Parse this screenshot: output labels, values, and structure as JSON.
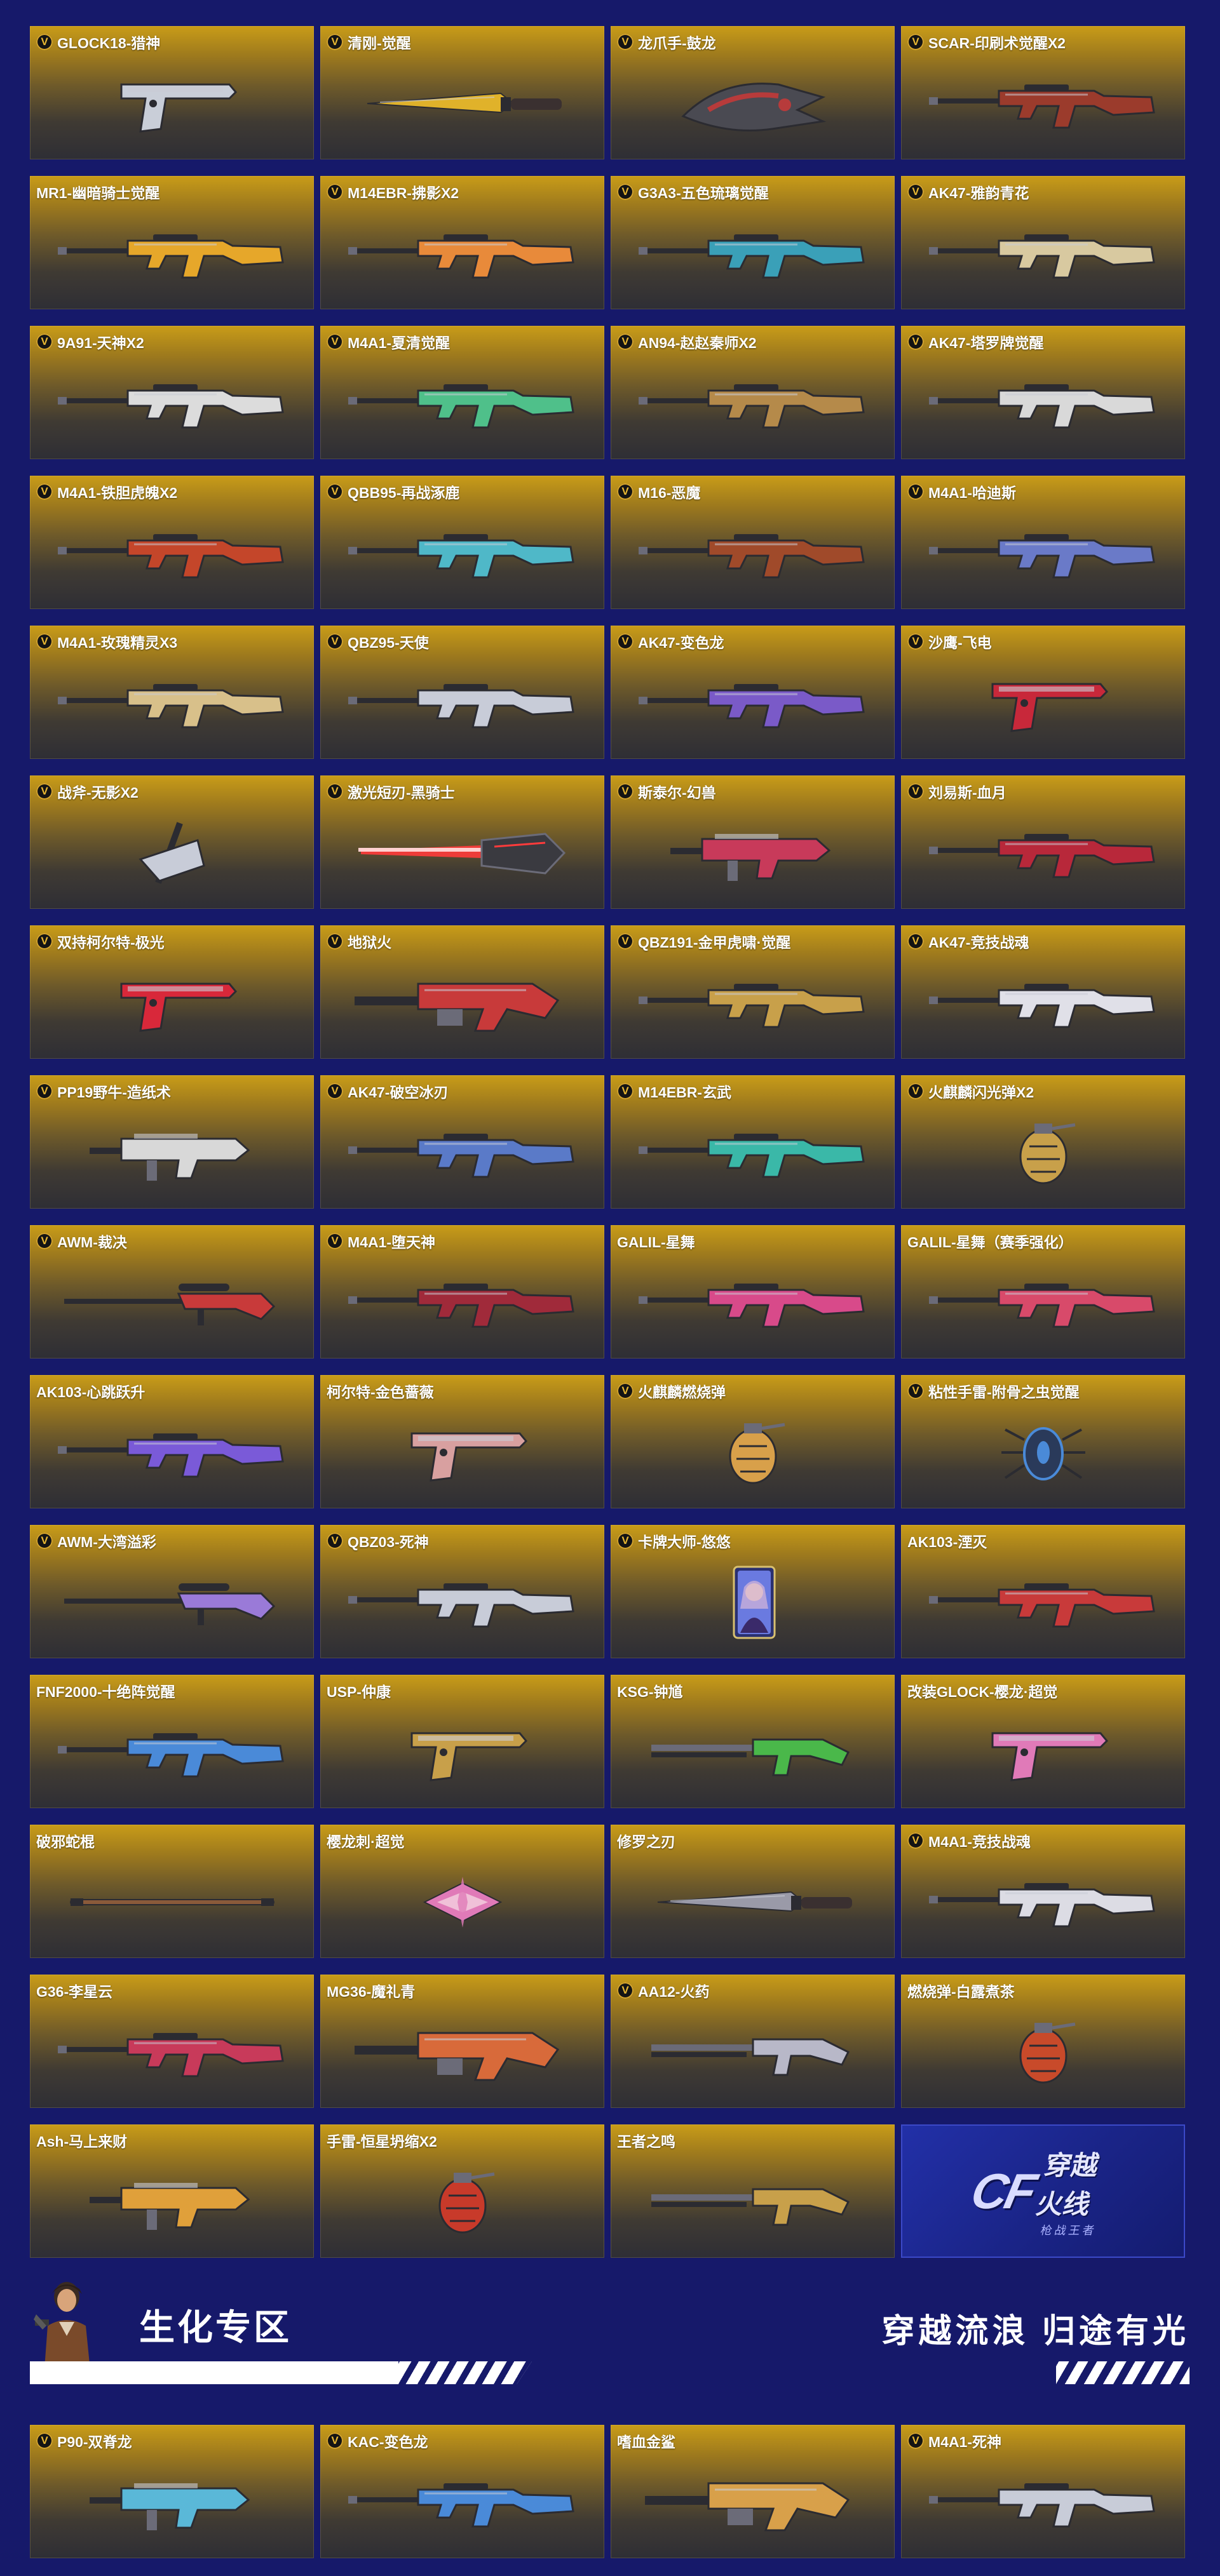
{
  "sections": {
    "bio_title": "生化专区",
    "slogan": "穿越流浪 归途有光",
    "logo_text": "穿越火线",
    "logo_sub": "枪战王者"
  },
  "colors": {
    "page_bg": "#16196a",
    "card_top": "#c99c18",
    "card_bottom": "#2e2e35",
    "badge_gold": "#e9b833"
  },
  "weapons": [
    {
      "name": "GLOCK18-猎神",
      "v": true,
      "icon": "pistol",
      "accent": "#c9ced8"
    },
    {
      "name": "清刚-觉醒",
      "v": true,
      "icon": "knife",
      "accent": "#e0b22a"
    },
    {
      "name": "龙爪手-鼓龙",
      "v": true,
      "icon": "claw",
      "accent": "#b73b3b"
    },
    {
      "name": "SCAR-印刷术觉醒X2",
      "v": true,
      "icon": "rifle",
      "accent": "#9b3b2c"
    },
    {
      "name": "MR1-幽暗骑士觉醒",
      "v": false,
      "icon": "rifle",
      "accent": "#e6a72a"
    },
    {
      "name": "M14EBR-拂影X2",
      "v": true,
      "icon": "rifle",
      "accent": "#e88a3a"
    },
    {
      "name": "G3A3-五色琉璃觉醒",
      "v": true,
      "icon": "rifle",
      "accent": "#3aa0b8"
    },
    {
      "name": "AK47-雅韵青花",
      "v": true,
      "icon": "rifle",
      "accent": "#d8c9a0"
    },
    {
      "name": "9A91-天神X2",
      "v": true,
      "icon": "rifle",
      "accent": "#dcdcdc"
    },
    {
      "name": "M4A1-夏清觉醒",
      "v": true,
      "icon": "rifle",
      "accent": "#4fc08a"
    },
    {
      "name": "AN94-赵赵秦师X2",
      "v": true,
      "icon": "rifle",
      "accent": "#b58a4a"
    },
    {
      "name": "AK47-塔罗牌觉醒",
      "v": true,
      "icon": "rifle",
      "accent": "#d9d9d9"
    },
    {
      "name": "M4A1-铁胆虎魄X2",
      "v": true,
      "icon": "rifle",
      "accent": "#c4462a"
    },
    {
      "name": "QBB95-再战涿鹿",
      "v": true,
      "icon": "rifle",
      "accent": "#4fb8c8"
    },
    {
      "name": "M16-恶魔",
      "v": true,
      "icon": "rifle",
      "accent": "#a04a2a"
    },
    {
      "name": "M4A1-哈迪斯",
      "v": true,
      "icon": "rifle",
      "accent": "#6a7ac8"
    },
    {
      "name": "M4A1-玫瑰精灵X3",
      "v": true,
      "icon": "rifle",
      "accent": "#d8c08a"
    },
    {
      "name": "QBZ95-天使",
      "v": true,
      "icon": "rifle",
      "accent": "#c8ccd8"
    },
    {
      "name": "AK47-变色龙",
      "v": true,
      "icon": "rifle",
      "accent": "#7a5ac8"
    },
    {
      "name": "沙鹰-飞电",
      "v": true,
      "icon": "pistol",
      "accent": "#c8283a"
    },
    {
      "name": "战斧-无影X2",
      "v": true,
      "icon": "axe",
      "accent": "#c8ccd8"
    },
    {
      "name": "激光短刃-黑骑士",
      "v": true,
      "icon": "laser",
      "accent": "#ff3b3b"
    },
    {
      "name": "斯泰尔-幻兽",
      "v": true,
      "icon": "smg",
      "accent": "#c83a5a"
    },
    {
      "name": "刘易斯-血月",
      "v": true,
      "icon": "rifle",
      "accent": "#b8283a"
    },
    {
      "name": "双持柯尔特-极光",
      "v": true,
      "icon": "pistol",
      "accent": "#d8283a"
    },
    {
      "name": "地狱火",
      "v": true,
      "icon": "heavy",
      "accent": "#c83a3a"
    },
    {
      "name": "QBZ191-金甲虎啸·觉醒",
      "v": true,
      "icon": "rifle",
      "accent": "#c8a04a"
    },
    {
      "name": "AK47-竞技战魂",
      "v": true,
      "icon": "rifle",
      "accent": "#e0e0e8"
    },
    {
      "name": "PP19野牛-造纸术",
      "v": true,
      "icon": "smg",
      "accent": "#d8d8d8"
    },
    {
      "name": "AK47-破空冰刃",
      "v": true,
      "icon": "rifle",
      "accent": "#5a7ac8"
    },
    {
      "name": "M14EBR-玄武",
      "v": true,
      "icon": "rifle",
      "accent": "#3ab8a8"
    },
    {
      "name": "火麒麟闪光弹X2",
      "v": true,
      "icon": "grenade",
      "accent": "#c8a04a"
    },
    {
      "name": "AWM-裁决",
      "v": true,
      "icon": "sniper",
      "accent": "#c83a3a"
    },
    {
      "name": "M4A1-堕天神",
      "v": true,
      "icon": "rifle",
      "accent": "#a02a3a"
    },
    {
      "name": "GALIL-星舞",
      "v": false,
      "icon": "rifle",
      "accent": "#d84a8a"
    },
    {
      "name": "GALIL-星舞（赛季强化）",
      "v": false,
      "icon": "rifle",
      "accent": "#d84a6a"
    },
    {
      "name": "AK103-心跳跃升",
      "v": false,
      "icon": "rifle",
      "accent": "#7a5ad8"
    },
    {
      "name": "柯尔特-金色蔷薇",
      "v": false,
      "icon": "pistol",
      "accent": "#d8a0a0"
    },
    {
      "name": "火麒麟燃烧弹",
      "v": true,
      "icon": "grenade",
      "accent": "#d8a04a"
    },
    {
      "name": "粘性手雷-附骨之虫觉醒",
      "v": true,
      "icon": "bug",
      "accent": "#4a8ad8"
    },
    {
      "name": "AWM-大湾溢彩",
      "v": true,
      "icon": "sniper",
      "accent": "#9a7ad8"
    },
    {
      "name": "QBZ03-死神",
      "v": true,
      "icon": "rifle",
      "accent": "#c8ccd8"
    },
    {
      "name": "卡牌大师-悠悠",
      "v": true,
      "icon": "card",
      "accent": "#6a7ae0"
    },
    {
      "name": "AK103-湮灭",
      "v": false,
      "icon": "rifle",
      "accent": "#c83a3a"
    },
    {
      "name": "FNF2000-十绝阵觉醒",
      "v": false,
      "icon": "rifle",
      "accent": "#4a8ad8"
    },
    {
      "name": "USP-仲康",
      "v": false,
      "icon": "pistol",
      "accent": "#c8a04a"
    },
    {
      "name": "KSG-钟馗",
      "v": false,
      "icon": "shotgun",
      "accent": "#4ab84a"
    },
    {
      "name": "改装GLOCK-樱龙·超觉",
      "v": false,
      "icon": "pistol",
      "accent": "#e07ab8"
    },
    {
      "name": "破邪蛇棍",
      "v": false,
      "icon": "staff",
      "accent": "#8a5a3a"
    },
    {
      "name": "樱龙刺·超觉",
      "v": false,
      "icon": "shuriken",
      "accent": "#e07ab8"
    },
    {
      "name": "修罗之刃",
      "v": false,
      "icon": "knife",
      "accent": "#9a9aa8"
    },
    {
      "name": "M4A1-竞技战魂",
      "v": true,
      "icon": "rifle",
      "accent": "#dcdce4"
    },
    {
      "name": "G36-李星云",
      "v": false,
      "icon": "rifle",
      "accent": "#c83a5a"
    },
    {
      "name": "MG36-魔礼青",
      "v": false,
      "icon": "heavy",
      "accent": "#d86a3a"
    },
    {
      "name": "AA12-火药",
      "v": true,
      "icon": "shotgun",
      "accent": "#b8b8c8"
    },
    {
      "name": "燃烧弹-白露煮茶",
      "v": false,
      "icon": "grenade",
      "accent": "#c84a2a"
    },
    {
      "name": "Ash-马上来财",
      "v": false,
      "icon": "smg",
      "accent": "#e0a03a"
    },
    {
      "name": "手雷-恒星坍缩X2",
      "v": false,
      "icon": "grenade",
      "accent": "#c83a2a"
    },
    {
      "name": "王者之鸣",
      "v": false,
      "icon": "shotgun",
      "accent": "#c8a04a"
    }
  ],
  "bio_weapons": [
    {
      "name": "P90-双脊龙",
      "v": true,
      "icon": "smg",
      "accent": "#5ab8d8"
    },
    {
      "name": "KAC-变色龙",
      "v": true,
      "icon": "rifle",
      "accent": "#4a8ad8"
    },
    {
      "name": "嗜血金鲨",
      "v": false,
      "icon": "heavy",
      "accent": "#d8a04a"
    },
    {
      "name": "M4A1-死神",
      "v": true,
      "icon": "rifle",
      "accent": "#c8ccd8"
    }
  ]
}
